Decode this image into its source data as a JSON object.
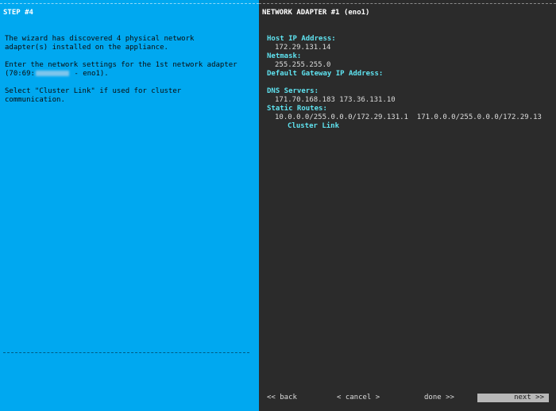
{
  "left": {
    "title": "STEP #4",
    "para1": [
      "The wizard has discovered 4 physical network",
      "adapter(s) installed on the appliance."
    ],
    "para2_line1": "Enter the network settings for the 1st network adapter",
    "para2_line2_prefix": "(70:69:",
    "para2_line2_suffix": " - eno1).",
    "para3": [
      "Select \"Cluster Link\" if used for cluster",
      "communication."
    ]
  },
  "right": {
    "title": "NETWORK ADAPTER #1 (eno1)",
    "host_ip_label": "Host IP Address:",
    "host_ip_value": "172.29.131.14",
    "netmask_label": "Netmask:",
    "netmask_value": "255.255.255.0",
    "gateway_label": "Default Gateway IP Address:",
    "dns_label": "DNS Servers:",
    "dns_value": "171.70.168.183 173.36.131.10",
    "routes_label": "Static Routes:",
    "routes_value": "10.0.0.0/255.0.0.0/172.29.131.1  171.0.0.0/255.0.0.0/172.29.13",
    "cluster_link": "Cluster Link"
  },
  "nav": {
    "back": "<< back",
    "cancel": "< cancel >",
    "done": "done >>",
    "next": "next >>"
  }
}
